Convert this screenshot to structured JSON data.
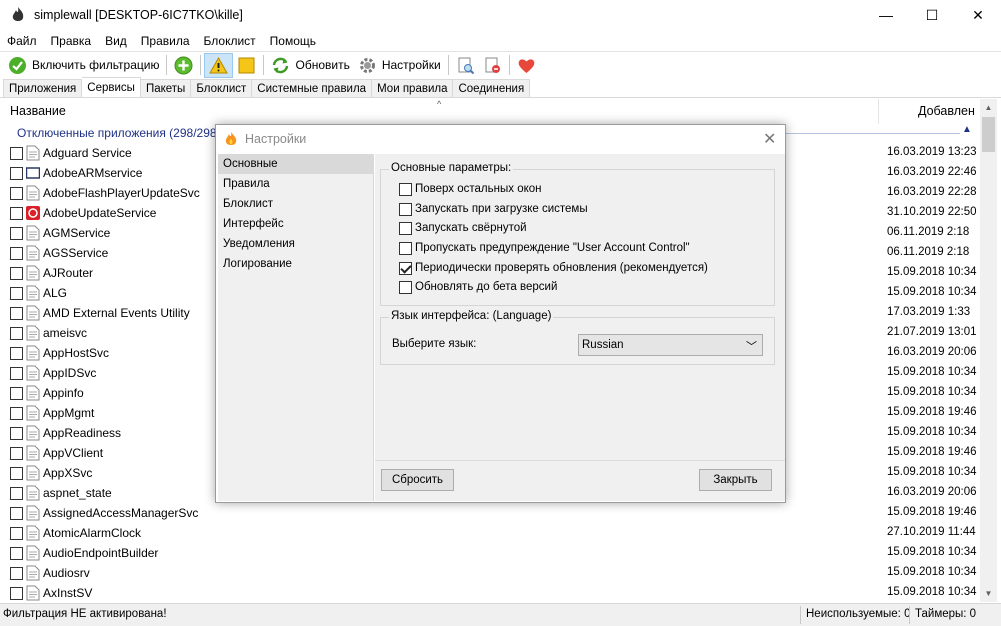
{
  "window": {
    "title": "simplewall [DESKTOP-6IC7TKO\\kille]",
    "minimize": "—",
    "maximize": "☐",
    "close": "✕"
  },
  "menu": [
    "Файл",
    "Правка",
    "Вид",
    "Правила",
    "Блоклист",
    "Помощь"
  ],
  "toolbar": {
    "enable_filtering": "Включить фильтрацию",
    "refresh": "Обновить",
    "settings": "Настройки"
  },
  "tabs": [
    "Приложения",
    "Сервисы",
    "Пакеты",
    "Блоклист",
    "Системные правила",
    "Мои правила",
    "Соединения"
  ],
  "list": {
    "col_name": "Название",
    "col_added": "Добавлен",
    "group_label": "Отключенные приложения (298/298)",
    "rows": [
      {
        "name": "Adguard Service",
        "date": "16.03.2019 13:23"
      },
      {
        "name": "AdobeARMservice",
        "date": "16.03.2019 22:46"
      },
      {
        "name": "AdobeFlashPlayerUpdateSvc",
        "date": "16.03.2019 22:28"
      },
      {
        "name": "AdobeUpdateService",
        "date": "31.10.2019 22:50"
      },
      {
        "name": "AGMService",
        "date": "06.11.2019 2:18"
      },
      {
        "name": "AGSService",
        "date": "06.11.2019 2:18"
      },
      {
        "name": "AJRouter",
        "date": "15.09.2018 10:34"
      },
      {
        "name": "ALG",
        "date": "15.09.2018 10:34"
      },
      {
        "name": "AMD External Events Utility",
        "date": "17.03.2019 1:33"
      },
      {
        "name": "ameisvc",
        "date": "21.07.2019 13:01"
      },
      {
        "name": "AppHostSvc",
        "date": "16.03.2019 20:06"
      },
      {
        "name": "AppIDSvc",
        "date": "15.09.2018 10:34"
      },
      {
        "name": "Appinfo",
        "date": "15.09.2018 10:34"
      },
      {
        "name": "AppMgmt",
        "date": "15.09.2018 19:46"
      },
      {
        "name": "AppReadiness",
        "date": "15.09.2018 10:34"
      },
      {
        "name": "AppVClient",
        "date": "15.09.2018 19:46"
      },
      {
        "name": "AppXSvc",
        "date": "15.09.2018 10:34"
      },
      {
        "name": "aspnet_state",
        "date": "16.03.2019 20:06"
      },
      {
        "name": "AssignedAccessManagerSvc",
        "date": "15.09.2018 19:46"
      },
      {
        "name": "AtomicAlarmClock",
        "date": "27.10.2019 11:44"
      },
      {
        "name": "AudioEndpointBuilder",
        "date": "15.09.2018 10:34"
      },
      {
        "name": "Audiosrv",
        "date": "15.09.2018 10:34"
      },
      {
        "name": "AxInstSV",
        "date": "15.09.2018 10:34"
      }
    ]
  },
  "status": {
    "filter_state": "Фильтрация НЕ активирована!",
    "unused": "Неиспользуемые: 0",
    "timers": "Таймеры: 0"
  },
  "dialog": {
    "title": "Настройки",
    "close": "✕",
    "nav": [
      "Основные",
      "Правила",
      "Блоклист",
      "Интерфейс",
      "Уведомления",
      "Логирование"
    ],
    "general_legend": "Основные параметры:",
    "options": [
      {
        "label": "Поверх остальных окон",
        "checked": false
      },
      {
        "label": "Запускать при загрузке системы",
        "checked": false
      },
      {
        "label": "Запускать свёрнутой",
        "checked": false
      },
      {
        "label": "Пропускать предупреждение \"User Account Control\"",
        "checked": false
      },
      {
        "label": "Периодически проверять обновления (рекомендуется)",
        "checked": true
      },
      {
        "label": "Обновлять до бета версий",
        "checked": false
      }
    ],
    "language_legend": "Язык интерфейса: (Language)",
    "language_label": "Выберите язык:",
    "language_value": "Russian",
    "reset": "Сбросить",
    "close_button": "Закрыть"
  }
}
